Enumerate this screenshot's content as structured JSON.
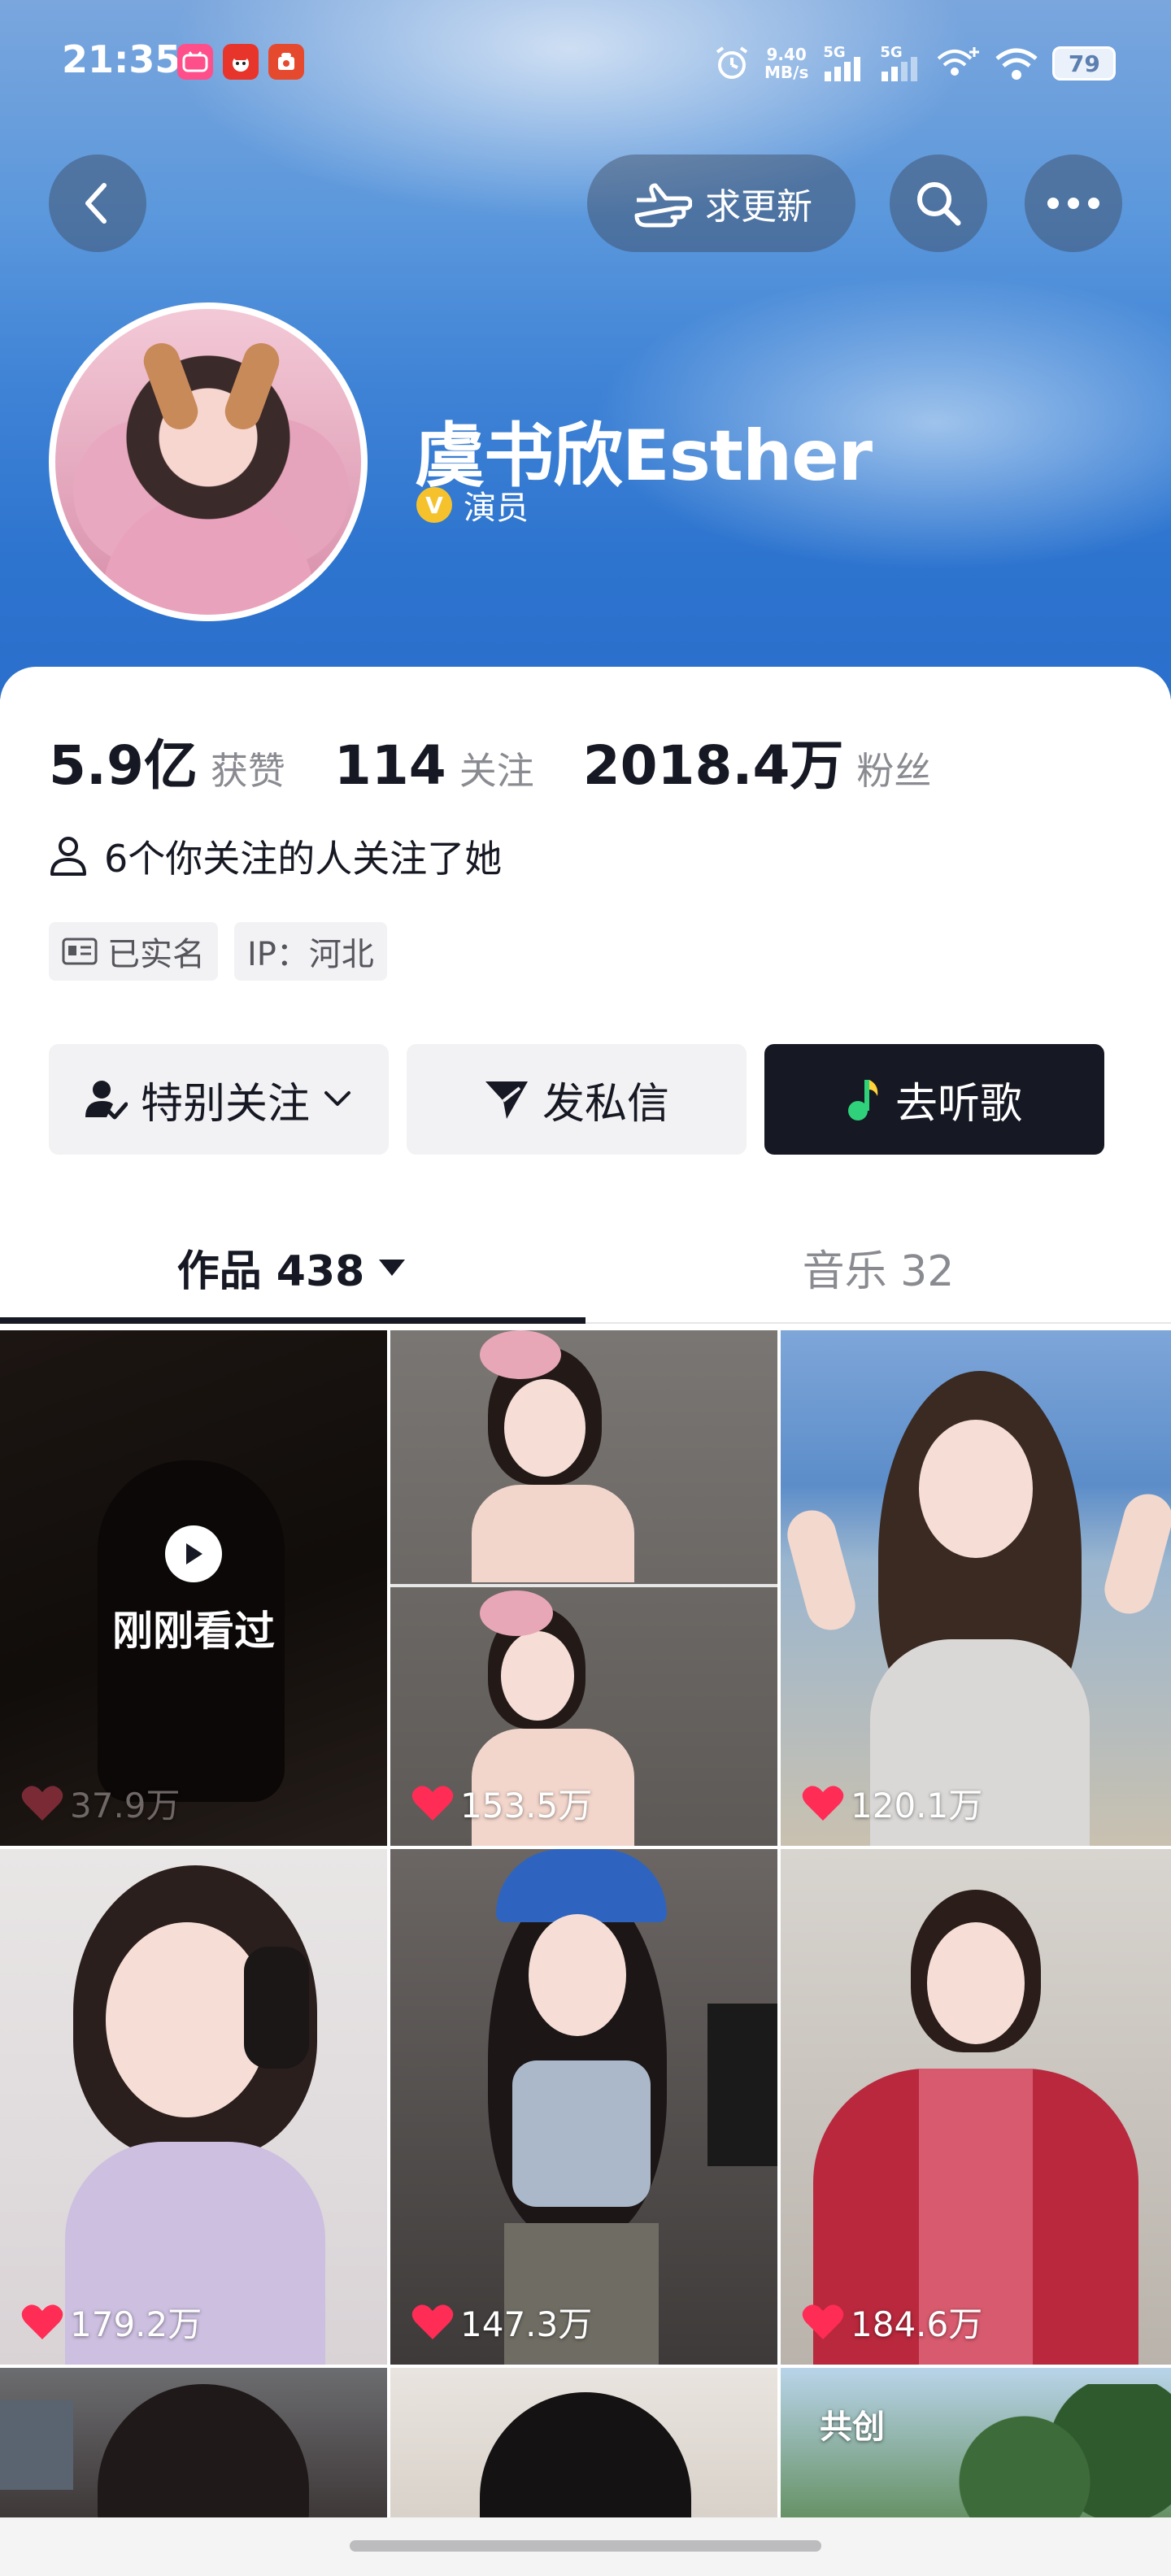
{
  "status_bar": {
    "time": "21:35",
    "net_speed_value": "9.40",
    "net_speed_unit": "MB/s",
    "signal1": "5G",
    "signal2": "5G",
    "battery": "79"
  },
  "header": {
    "request_update_label": "求更新"
  },
  "profile": {
    "name": "虞书欣Esther",
    "verified_badge": "V",
    "role": "演员"
  },
  "stats": {
    "likes_value": "5.9亿",
    "likes_label": "获赞",
    "following_value": "114",
    "following_label": "关注",
    "followers_value": "2018.4万",
    "followers_label": "粉丝"
  },
  "mutual_text": "6个你关注的人关注了她",
  "tags": [
    "已实名",
    "IP：河北"
  ],
  "actions": {
    "special_follow": "特别关注",
    "message": "发私信",
    "listen": "去听歌"
  },
  "tabs": {
    "works": "作品 438",
    "music": "音乐 32"
  },
  "videos": [
    {
      "likes": "37.9万",
      "overlay": "刚刚看过"
    },
    {
      "likes": "153.5万"
    },
    {
      "likes": "120.1万"
    },
    {
      "likes": "179.2万"
    },
    {
      "likes": "147.3万"
    },
    {
      "likes": "184.6万"
    },
    {
      "likes": ""
    },
    {
      "likes": ""
    },
    {
      "likes": "",
      "label": "共创"
    }
  ],
  "colors": {
    "like_red": "#ff2c55",
    "dark_button": "#161823",
    "header_blue": "#3f83d6"
  }
}
